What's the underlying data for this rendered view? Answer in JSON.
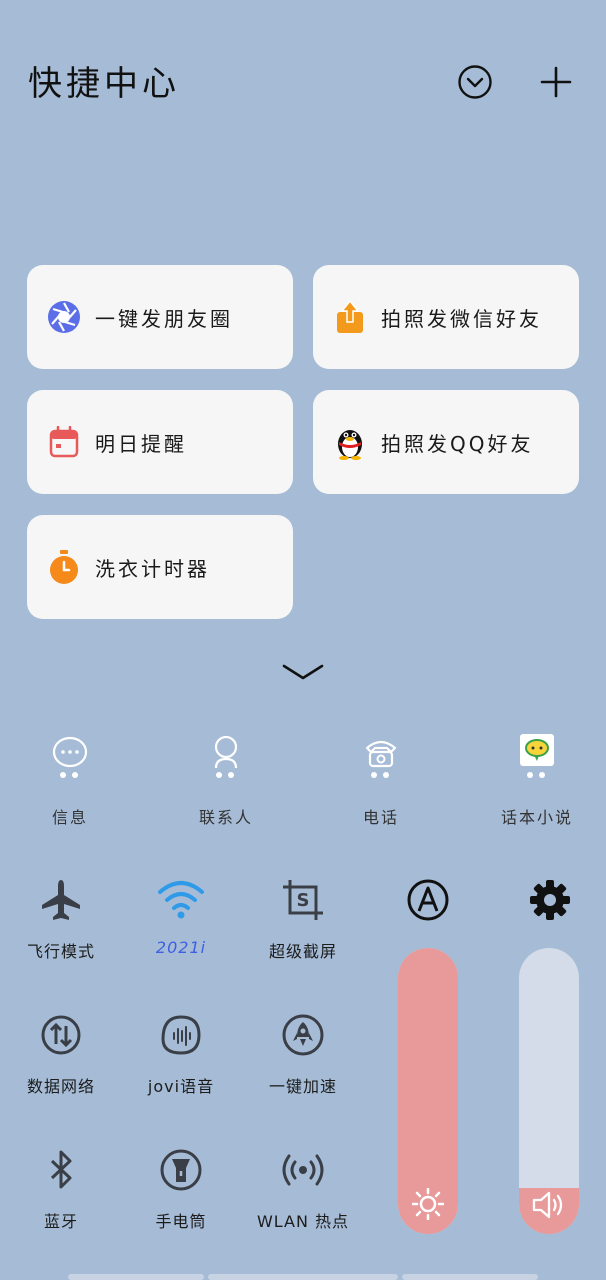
{
  "header": {
    "title": "快捷中心",
    "collapse_icon": "chevron-circle-icon",
    "add_icon": "plus-icon"
  },
  "shortcuts": [
    {
      "label": "一键发朋友圈",
      "icon": "aperture-icon",
      "color": "#5b6ee8"
    },
    {
      "label": "拍照发微信好友",
      "icon": "upload-box-icon",
      "color": "#f39a1c"
    },
    {
      "label": "明日提醒",
      "icon": "calendar-icon",
      "color": "#e85a5a"
    },
    {
      "label": "拍照发QQ好友",
      "icon": "penguin-icon",
      "color": "#e02020"
    },
    {
      "label": "洗衣计时器",
      "icon": "stopwatch-icon",
      "color": "#f5891a"
    }
  ],
  "expand_icon": "chevron-down-icon",
  "apps": [
    {
      "label": "信息",
      "icon": "message-bubble-icon"
    },
    {
      "label": "联系人",
      "icon": "contact-icon"
    },
    {
      "label": "电话",
      "icon": "telephone-icon"
    },
    {
      "label": "话本小说",
      "icon": "novel-app-icon"
    }
  ],
  "toggles": [
    {
      "label": "飞行模式",
      "icon": "airplane-icon",
      "active": false
    },
    {
      "label": "2021i",
      "icon": "wifi-icon",
      "active": true
    },
    {
      "label": "超级截屏",
      "icon": "screenshot-icon",
      "active": false
    },
    {
      "label": "数据网络",
      "icon": "mobile-data-icon",
      "active": false
    },
    {
      "label": "jovi语音",
      "icon": "voice-assistant-icon",
      "active": false
    },
    {
      "label": "一键加速",
      "icon": "rocket-icon",
      "active": false
    },
    {
      "label": "蓝牙",
      "icon": "bluetooth-icon",
      "active": false
    },
    {
      "label": "手电筒",
      "icon": "flashlight-icon",
      "active": false
    },
    {
      "label": "WLAN 热点",
      "icon": "hotspot-icon",
      "active": false
    }
  ],
  "auto_brightness_icon": "auto-brightness-icon",
  "settings_icon": "gear-icon",
  "sliders": {
    "brightness": {
      "level": 1.0,
      "fill_color": "#e89a9a",
      "icon": "sun-icon"
    },
    "volume": {
      "level": 0.16,
      "fill_color": "#e89a9a",
      "track_color": "#d3dce8",
      "icon": "speaker-icon"
    }
  },
  "colors": {
    "background": "#a6bcd6",
    "card": "#f6f6f6",
    "accent_active": "#3d5fe0"
  }
}
